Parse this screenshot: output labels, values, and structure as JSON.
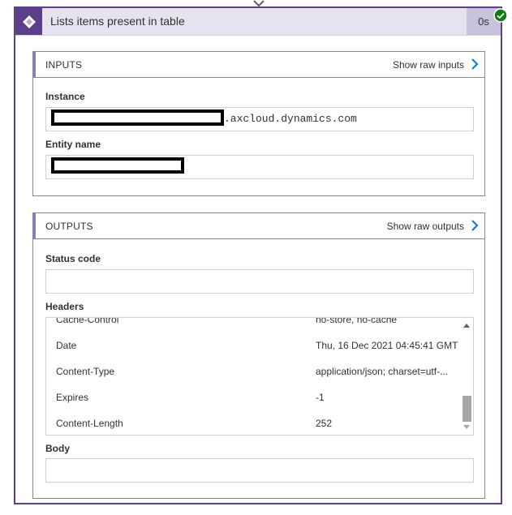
{
  "card": {
    "title": "Lists items present in table",
    "duration": "0s"
  },
  "inputs": {
    "section_title": "INPUTS",
    "raw_link": "Show raw inputs",
    "instance_label": "Instance",
    "instance_suffix": ".axcloud.dynamics.com",
    "entity_label": "Entity name"
  },
  "outputs": {
    "section_title": "OUTPUTS",
    "raw_link": "Show raw outputs",
    "status_code_label": "Status code",
    "status_code_value": "",
    "headers_label": "Headers",
    "headers": [
      {
        "key": "Cache-Control",
        "value": "no-store, no-cache"
      },
      {
        "key": "Date",
        "value": "Thu, 16 Dec 2021 04:45:41 GMT"
      },
      {
        "key": "Content-Type",
        "value": "application/json; charset=utf-..."
      },
      {
        "key": "Expires",
        "value": "-1"
      },
      {
        "key": "Content-Length",
        "value": "252"
      }
    ],
    "body_label": "Body",
    "body_value": ""
  },
  "colors": {
    "accent": "#5c3f8a",
    "header_bg": "#e6e3ef",
    "link_chevron": "#0078d4",
    "success": "#107c10"
  },
  "icons": [
    "flow-arrow-icon",
    "dynamics-diamond-icon",
    "success-check-icon",
    "chevron-right-icon"
  ]
}
